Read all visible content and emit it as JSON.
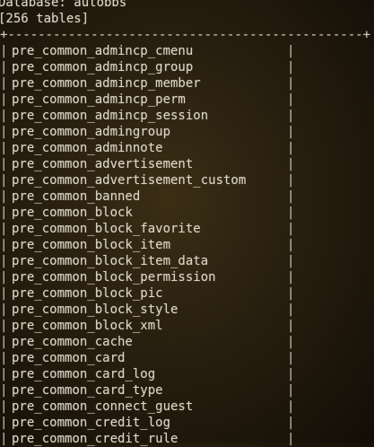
{
  "terminal": {
    "database_line": "Database: autobbs",
    "count_line": "[256 tables]",
    "top_border": "+-----------------------------------------------+",
    "pipe": "|",
    "tables": [
      "pre_common_admincp_cmenu",
      "pre_common_admincp_group",
      "pre_common_admincp_member",
      "pre_common_admincp_perm",
      "pre_common_admincp_session",
      "pre_common_admingroup",
      "pre_common_adminnote",
      "pre_common_advertisement",
      "pre_common_advertisement_custom",
      "pre_common_banned",
      "pre_common_block",
      "pre_common_block_favorite",
      "pre_common_block_item",
      "pre_common_block_item_data",
      "pre_common_block_permission",
      "pre_common_block_pic",
      "pre_common_block_style",
      "pre_common_block_xml",
      "pre_common_cache",
      "pre_common_card",
      "pre_common_card_log",
      "pre_common_card_type",
      "pre_common_connect_guest",
      "pre_common_credit_log",
      "pre_common_credit_rule"
    ]
  }
}
